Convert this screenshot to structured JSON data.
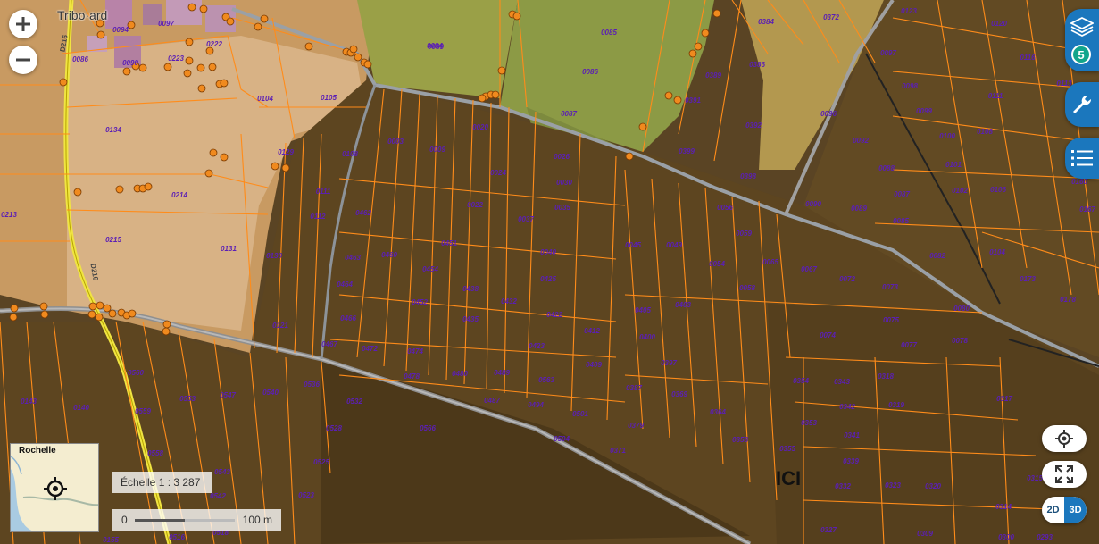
{
  "map": {
    "town_label": "Tribo·ard",
    "road_labels": [
      "D216",
      "D216"
    ],
    "marker_label": "ICI",
    "parcels": [
      {
        "id": "0094"
      },
      {
        "id": "0097"
      },
      {
        "id": "0222"
      },
      {
        "id": "0086"
      },
      {
        "id": "0090"
      },
      {
        "id": "0223"
      },
      {
        "id": "0084"
      },
      {
        "id": "0089"
      },
      {
        "id": "0085"
      },
      {
        "id": "0086"
      },
      {
        "id": "0087"
      },
      {
        "id": "0384"
      },
      {
        "id": "0386"
      },
      {
        "id": "0389"
      },
      {
        "id": "0391"
      },
      {
        "id": "0392"
      },
      {
        "id": "0372"
      },
      {
        "id": "0123"
      },
      {
        "id": "0120"
      },
      {
        "id": "0116"
      },
      {
        "id": "0113"
      },
      {
        "id": "0097"
      },
      {
        "id": "0098"
      },
      {
        "id": "0111"
      },
      {
        "id": "0099"
      },
      {
        "id": "0108"
      },
      {
        "id": "0100"
      },
      {
        "id": "0101"
      },
      {
        "id": "0102"
      },
      {
        "id": "0106"
      },
      {
        "id": "0160"
      },
      {
        "id": "0167"
      },
      {
        "id": "0096"
      },
      {
        "id": "0092"
      },
      {
        "id": "0088"
      },
      {
        "id": "0087"
      },
      {
        "id": "0085"
      },
      {
        "id": "0090"
      },
      {
        "id": "0089"
      },
      {
        "id": "0082"
      },
      {
        "id": "0104"
      },
      {
        "id": "0173"
      },
      {
        "id": "0178"
      },
      {
        "id": "0080"
      },
      {
        "id": "0078"
      },
      {
        "id": "0077"
      },
      {
        "id": "0075"
      },
      {
        "id": "0074"
      },
      {
        "id": "0073"
      },
      {
        "id": "0072"
      },
      {
        "id": "0067"
      },
      {
        "id": "0065"
      },
      {
        "id": "0059"
      },
      {
        "id": "0058"
      },
      {
        "id": "0056"
      },
      {
        "id": "0054"
      },
      {
        "id": "0049"
      },
      {
        "id": "0045"
      },
      {
        "id": "0398"
      },
      {
        "id": "0399"
      },
      {
        "id": "0134"
      },
      {
        "id": "0104"
      },
      {
        "id": "0105"
      },
      {
        "id": "0129"
      },
      {
        "id": "0214"
      },
      {
        "id": "0213"
      },
      {
        "id": "0215"
      },
      {
        "id": "0131"
      },
      {
        "id": "0108"
      },
      {
        "id": "0111"
      },
      {
        "id": "0112"
      },
      {
        "id": "0130"
      },
      {
        "id": "0121"
      },
      {
        "id": "0003"
      },
      {
        "id": "0009"
      },
      {
        "id": "0020"
      },
      {
        "id": "0024"
      },
      {
        "id": "0026"
      },
      {
        "id": "0030"
      },
      {
        "id": "0035"
      },
      {
        "id": "0022"
      },
      {
        "id": "0037"
      },
      {
        "id": "0462"
      },
      {
        "id": "0463"
      },
      {
        "id": "0460"
      },
      {
        "id": "0451"
      },
      {
        "id": "0454"
      },
      {
        "id": "0040"
      },
      {
        "id": "0425"
      },
      {
        "id": "0464"
      },
      {
        "id": "0452"
      },
      {
        "id": "0438"
      },
      {
        "id": "0432"
      },
      {
        "id": "0422"
      },
      {
        "id": "0435"
      },
      {
        "id": "0466"
      },
      {
        "id": "0412"
      },
      {
        "id": "0405"
      },
      {
        "id": "0403"
      },
      {
        "id": "0400"
      },
      {
        "id": "0467"
      },
      {
        "id": "0472"
      },
      {
        "id": "0474"
      },
      {
        "id": "0423"
      },
      {
        "id": "0409"
      },
      {
        "id": "0397"
      },
      {
        "id": "0478"
      },
      {
        "id": "0480"
      },
      {
        "id": "0489"
      },
      {
        "id": "0563"
      },
      {
        "id": "0387"
      },
      {
        "id": "0369"
      },
      {
        "id": "0487"
      },
      {
        "id": "0494"
      },
      {
        "id": "0501"
      },
      {
        "id": "0364"
      },
      {
        "id": "0379"
      },
      {
        "id": "0504"
      },
      {
        "id": "0371"
      },
      {
        "id": "0358"
      },
      {
        "id": "0355"
      },
      {
        "id": "0354"
      },
      {
        "id": "0343"
      },
      {
        "id": "0318"
      },
      {
        "id": "0342"
      },
      {
        "id": "0319"
      },
      {
        "id": "0353"
      },
      {
        "id": "0341"
      },
      {
        "id": "0339"
      },
      {
        "id": "0332"
      },
      {
        "id": "0323"
      },
      {
        "id": "0320"
      },
      {
        "id": "0317"
      },
      {
        "id": "0315"
      },
      {
        "id": "0314"
      },
      {
        "id": "0309"
      },
      {
        "id": "0327"
      },
      {
        "id": "0300"
      },
      {
        "id": "0293"
      },
      {
        "id": "0560"
      },
      {
        "id": "0553"
      },
      {
        "id": "0547"
      },
      {
        "id": "0540"
      },
      {
        "id": "0536"
      },
      {
        "id": "0532"
      },
      {
        "id": "0559"
      },
      {
        "id": "0528"
      },
      {
        "id": "0566"
      },
      {
        "id": "0558"
      },
      {
        "id": "0525"
      },
      {
        "id": "0543"
      },
      {
        "id": "0523"
      },
      {
        "id": "0542"
      },
      {
        "id": "0143"
      },
      {
        "id": "0140"
      },
      {
        "id": "0155"
      },
      {
        "id": "0516"
      },
      {
        "id": "0518"
      }
    ]
  },
  "controls": {
    "zoom_in": "+",
    "zoom_out": "−",
    "layers_count": "5",
    "mode_2d": "2D",
    "mode_3d": "3D"
  },
  "minimap": {
    "label": "Rochelle"
  },
  "scale": {
    "ratio_text": "Échelle 1 : 3 287",
    "bar_zero": "0",
    "bar_length": "100 m"
  },
  "colors": {
    "parcel_line": "#ff8c1a",
    "parcel_label": "#5b1fb5",
    "accent": "#1b77bd",
    "badge": "#12a58b"
  }
}
